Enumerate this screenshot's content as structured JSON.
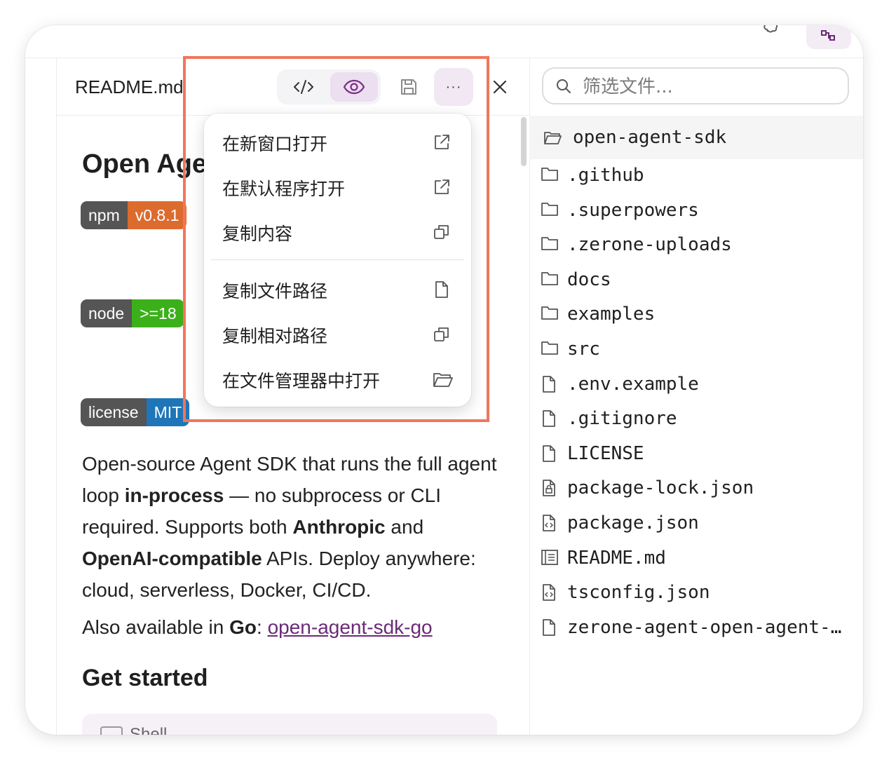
{
  "editor": {
    "filename": "README.md",
    "tools": {
      "code_icon": "code-icon",
      "preview_icon": "eye-icon",
      "save_icon": "save-icon",
      "more_label": "···",
      "close_icon": "close-icon"
    }
  },
  "readme": {
    "title": "Open Agent SDK",
    "badges": [
      {
        "key": "npm",
        "value": "v0.8.1",
        "color": "#dc6b2e"
      },
      {
        "key": "node",
        "value": ">=18",
        "color": "#3cb01a"
      },
      {
        "key": "license",
        "value": "MIT",
        "color": "#1e76b8"
      }
    ],
    "intro": {
      "t1": "Open-source Agent SDK that runs the full agent loop ",
      "b1": "in-process",
      "t2": " — no subprocess or CLI required. Supports both ",
      "b2": "Anthropic",
      "t3": " and ",
      "b3": "OpenAI-compatible",
      "t4": " APIs. Deploy anywhere: cloud, serverless, Docker, CI/CD."
    },
    "also": {
      "prefix": "Also available in ",
      "lang": "Go",
      "colon": ": ",
      "link": "open-agent-sdk-go"
    },
    "get_started": "Get started",
    "code_block_label": "Shell"
  },
  "context_menu": {
    "items": [
      {
        "label": "在新窗口打开",
        "icon": "external-link-icon"
      },
      {
        "label": "在默认程序打开",
        "icon": "external-link-icon"
      },
      {
        "label": "复制内容",
        "icon": "copy-icon"
      },
      {
        "label": "复制文件路径",
        "icon": "file-icon"
      },
      {
        "label": "复制相对路径",
        "icon": "copy-icon"
      },
      {
        "label": "在文件管理器中打开",
        "icon": "folder-open-icon"
      }
    ]
  },
  "explorer": {
    "filter_placeholder": "筛选文件...",
    "root": "open-agent-sdk",
    "items": [
      {
        "name": ".github",
        "icon": "folder-icon"
      },
      {
        "name": ".superpowers",
        "icon": "folder-icon"
      },
      {
        "name": ".zerone-uploads",
        "icon": "folder-icon"
      },
      {
        "name": "docs",
        "icon": "folder-icon"
      },
      {
        "name": "examples",
        "icon": "folder-icon"
      },
      {
        "name": "src",
        "icon": "folder-icon"
      },
      {
        "name": ".env.example",
        "icon": "file-icon"
      },
      {
        "name": ".gitignore",
        "icon": "file-icon"
      },
      {
        "name": "LICENSE",
        "icon": "file-icon"
      },
      {
        "name": "package-lock.json",
        "icon": "lock-file-icon"
      },
      {
        "name": "package.json",
        "icon": "code-file-icon"
      },
      {
        "name": "README.md",
        "icon": "readme-file-icon"
      },
      {
        "name": "tsconfig.json",
        "icon": "code-file-icon"
      },
      {
        "name": "zerone-agent-open-agent-sdk.md",
        "icon": "file-icon"
      }
    ]
  },
  "colors": {
    "accent": "#7a2f88",
    "highlight": "#f1765b",
    "link": "#6b2a78"
  }
}
